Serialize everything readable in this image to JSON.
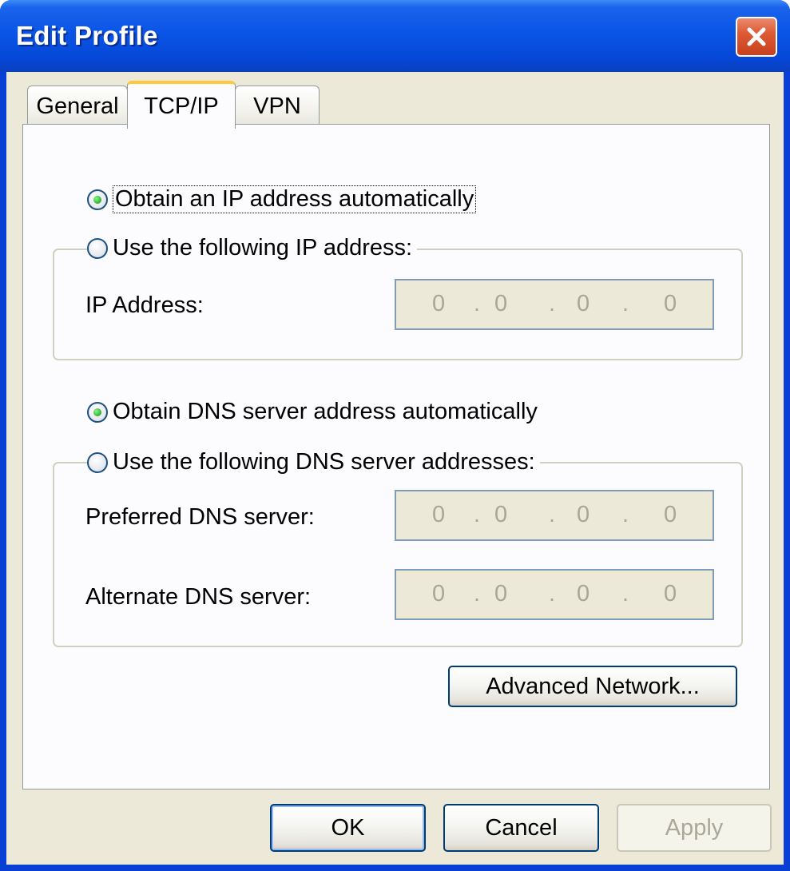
{
  "window": {
    "title": "Edit Profile"
  },
  "tabs": [
    {
      "label": "General",
      "selected": false
    },
    {
      "label": "TCP/IP",
      "selected": true
    },
    {
      "label": "VPN",
      "selected": false
    }
  ],
  "ip": {
    "auto_label": "Obtain an IP address automatically",
    "auto_selected": true,
    "manual_label": "Use the following IP address:",
    "manual_selected": false,
    "address_label": "IP Address:",
    "address_octets": [
      "0",
      "0",
      "0",
      "0"
    ]
  },
  "dns": {
    "auto_label": "Obtain DNS server address automatically",
    "auto_selected": true,
    "manual_label": "Use the following DNS server addresses:",
    "manual_selected": false,
    "preferred_label": "Preferred DNS server:",
    "preferred_octets": [
      "0",
      "0",
      "0",
      "0"
    ],
    "alternate_label": "Alternate DNS server:",
    "alternate_octets": [
      "0",
      "0",
      "0",
      "0"
    ]
  },
  "buttons": {
    "advanced": "Advanced Network...",
    "ok": "OK",
    "cancel": "Cancel",
    "apply": "Apply",
    "apply_enabled": false
  },
  "icons": {
    "close": "close-icon",
    "radio_selected": "radio-selected-icon",
    "radio_unselected": "radio-unselected-icon"
  },
  "colors": {
    "titlebar": "#0a55e6",
    "dialog_bg": "#ece9d8",
    "tab_highlight": "#ffc83c",
    "close_button": "#dd5a35"
  }
}
